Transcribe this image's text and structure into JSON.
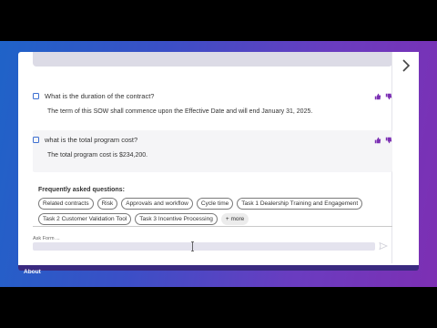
{
  "qa": [
    {
      "question": "What is the duration of the contract?",
      "answer": "The term of this SOW shall commence upon the Effective Date and will end January 31, 2025."
    },
    {
      "question": "what is the total program cost?",
      "answer": "The total program cost is $234,200."
    }
  ],
  "faq": {
    "title": "Frequently asked questions:",
    "chips": [
      "Related contracts",
      "Risk",
      "Approvals and workflow",
      "Cycle time",
      "Task 1 Dealership Training and Engagement",
      "Task 2 Customer Validation Tool",
      "Task 3 Incentive Processing"
    ],
    "more": "+ more"
  },
  "ask": {
    "label": "Ask Form ..."
  },
  "footer": {
    "about": "About"
  },
  "colors": {
    "accent": "#7b2fb3",
    "checkbox": "#3d6fd1"
  },
  "icons": [
    "thumbs-up-icon",
    "thumbs-down-icon",
    "chevron-right-icon",
    "send-icon",
    "text-cursor-icon"
  ]
}
